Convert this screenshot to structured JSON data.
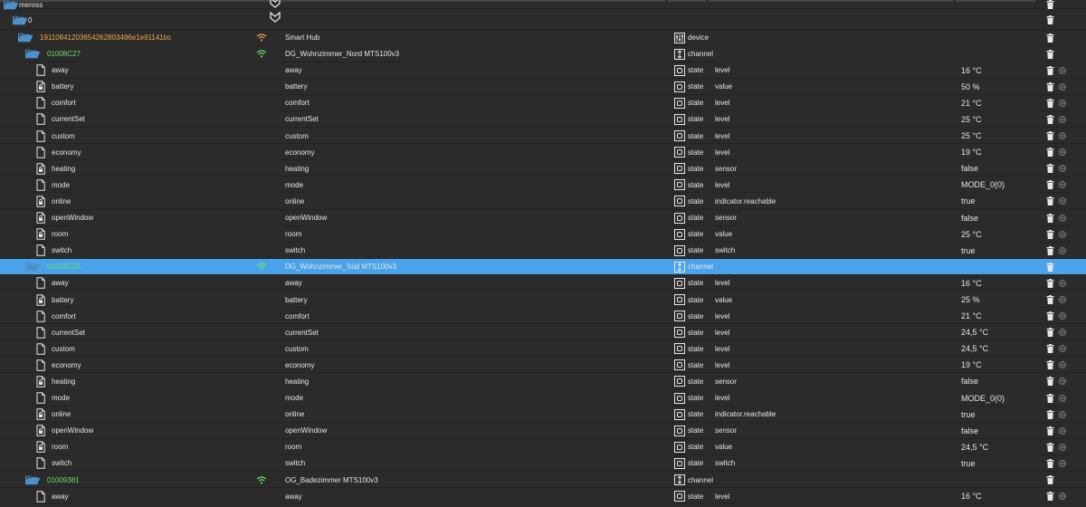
{
  "header": {
    "root": "meross",
    "instance": "0"
  },
  "rows": [
    {
      "kind": "device",
      "name": "19110841203654262803486e1e91141bc",
      "title": "Smart Hub",
      "type": "device",
      "role": "",
      "value": "",
      "indent": 1,
      "color": "orange",
      "wifi": "weak"
    },
    {
      "kind": "channel",
      "name": "01008C27",
      "title": "DG_Wohnzimmer_Nord MTS100v3",
      "type": "channel",
      "role": "",
      "value": "",
      "indent": 2,
      "color": "green",
      "wifi": "full"
    },
    {
      "kind": "state",
      "name": "away",
      "title": "away",
      "type": "state",
      "role": "level",
      "value": "16 °C",
      "indent": 3
    },
    {
      "kind": "state",
      "name": "battery",
      "title": "battery",
      "type": "state",
      "role": "value",
      "value": "50 %",
      "indent": 3,
      "lock": true
    },
    {
      "kind": "state",
      "name": "comfort",
      "title": "comfort",
      "type": "state",
      "role": "level",
      "value": "21 °C",
      "indent": 3
    },
    {
      "kind": "state",
      "name": "currentSet",
      "title": "currentSet",
      "type": "state",
      "role": "level",
      "value": "25 °C",
      "indent": 3
    },
    {
      "kind": "state",
      "name": "custom",
      "title": "custom",
      "type": "state",
      "role": "level",
      "value": "25 °C",
      "indent": 3
    },
    {
      "kind": "state",
      "name": "economy",
      "title": "economy",
      "type": "state",
      "role": "level",
      "value": "19 °C",
      "indent": 3
    },
    {
      "kind": "state",
      "name": "heating",
      "title": "heating",
      "type": "state",
      "role": "sensor",
      "value": "false",
      "indent": 3,
      "lock": true
    },
    {
      "kind": "state",
      "name": "mode",
      "title": "mode",
      "type": "state",
      "role": "level",
      "value": "MODE_0(0)",
      "indent": 3
    },
    {
      "kind": "state",
      "name": "online",
      "title": "online",
      "type": "state",
      "role": "indicator.reachable",
      "value": "true",
      "indent": 3,
      "lock": true
    },
    {
      "kind": "state",
      "name": "openWindow",
      "title": "openWindow",
      "type": "state",
      "role": "sensor",
      "value": "false",
      "indent": 3,
      "lock": true
    },
    {
      "kind": "state",
      "name": "room",
      "title": "room",
      "type": "state",
      "role": "value",
      "value": "25 °C",
      "indent": 3,
      "lock": true
    },
    {
      "kind": "state",
      "name": "switch",
      "title": "switch",
      "type": "state",
      "role": "switch",
      "value": "true",
      "indent": 3
    },
    {
      "kind": "channel",
      "name": "01008C35",
      "title": "DG_Wohnzimmer_Süd MTS100v3",
      "type": "channel",
      "role": "",
      "value": "",
      "indent": 2,
      "color": "green",
      "wifi": "full",
      "selected": true
    },
    {
      "kind": "state",
      "name": "away",
      "title": "away",
      "type": "state",
      "role": "level",
      "value": "16 °C",
      "indent": 3
    },
    {
      "kind": "state",
      "name": "battery",
      "title": "battery",
      "type": "state",
      "role": "value",
      "value": "25 %",
      "indent": 3,
      "lock": true
    },
    {
      "kind": "state",
      "name": "comfort",
      "title": "comfort",
      "type": "state",
      "role": "level",
      "value": "21 °C",
      "indent": 3
    },
    {
      "kind": "state",
      "name": "currentSet",
      "title": "currentSet",
      "type": "state",
      "role": "level",
      "value": "24,5 °C",
      "indent": 3
    },
    {
      "kind": "state",
      "name": "custom",
      "title": "custom",
      "type": "state",
      "role": "level",
      "value": "24,5 °C",
      "indent": 3
    },
    {
      "kind": "state",
      "name": "economy",
      "title": "economy",
      "type": "state",
      "role": "level",
      "value": "19 °C",
      "indent": 3
    },
    {
      "kind": "state",
      "name": "heating",
      "title": "heating",
      "type": "state",
      "role": "sensor",
      "value": "false",
      "indent": 3,
      "lock": true
    },
    {
      "kind": "state",
      "name": "mode",
      "title": "mode",
      "type": "state",
      "role": "level",
      "value": "MODE_0(0)",
      "indent": 3
    },
    {
      "kind": "state",
      "name": "online",
      "title": "online",
      "type": "state",
      "role": "indicator.reachable",
      "value": "true",
      "indent": 3,
      "lock": true
    },
    {
      "kind": "state",
      "name": "openWindow",
      "title": "openWindow",
      "type": "state",
      "role": "sensor",
      "value": "false",
      "indent": 3,
      "lock": true
    },
    {
      "kind": "state",
      "name": "room",
      "title": "room",
      "type": "state",
      "role": "value",
      "value": "24,5 °C",
      "indent": 3,
      "lock": true
    },
    {
      "kind": "state",
      "name": "switch",
      "title": "switch",
      "type": "state",
      "role": "switch",
      "value": "true",
      "indent": 3
    },
    {
      "kind": "channel",
      "name": "01009381",
      "title": "OG_Badezimmer MTS100v3",
      "type": "channel",
      "role": "",
      "value": "",
      "indent": 2,
      "color": "green",
      "wifi": "full"
    },
    {
      "kind": "state",
      "name": "away",
      "title": "away",
      "type": "state",
      "role": "level",
      "value": "16 °C",
      "indent": 3
    }
  ],
  "colors": {
    "background": "#2b2b2b",
    "selected": "#4aa3ea",
    "folder": "#4e91c8",
    "device_text": "#f0a64a",
    "channel_text": "#6ddc6d",
    "wifi_full": "#6ddc6d",
    "wifi_weak": "#e8a23a"
  },
  "icons": {
    "folder": "folder-open-icon",
    "file": "file-icon",
    "trash": "trash-icon",
    "gear": "gear-icon",
    "wifi": "wifi-icon",
    "collapse": "chevron-collapse-icon"
  }
}
